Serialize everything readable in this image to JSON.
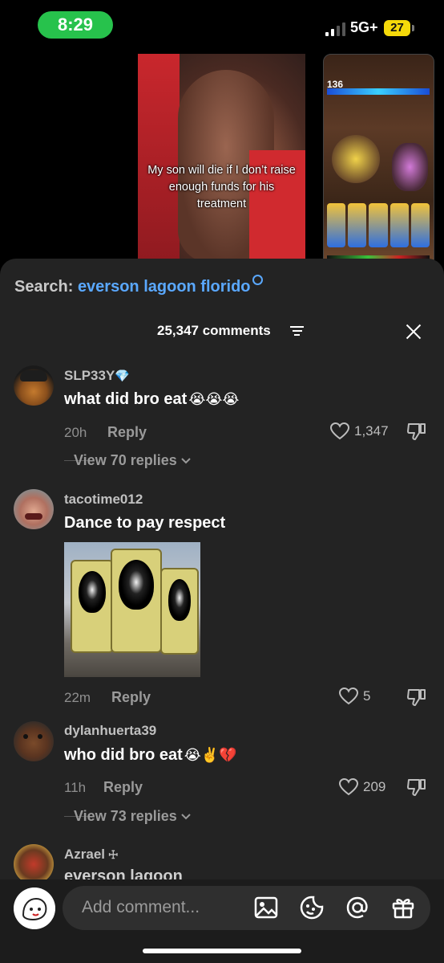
{
  "status_bar": {
    "time": "8:29",
    "network": "5G+",
    "battery": "27"
  },
  "video_left": {
    "caption": "My son will die if I don’t raise enough funds for his treatment"
  },
  "video_right": {
    "hud_number": "136"
  },
  "search": {
    "label": "Search:",
    "query": "everson lagoon florido"
  },
  "header": {
    "count_label": "25,347 comments"
  },
  "comments": [
    {
      "username": "SLP33Y",
      "badge": "💎",
      "text": "what did bro eat",
      "emojis": "😭😭😭",
      "time": "20h",
      "reply_label": "Reply",
      "likes": "1,347",
      "view_replies": "View 70 replies"
    },
    {
      "username": "tacotime012",
      "text": "Dance to pay respect",
      "time": "22m",
      "reply_label": "Reply",
      "likes": "5"
    },
    {
      "username": "dylanhuerta39",
      "text": "who did bro eat",
      "emojis": "😭✌️💔",
      "time": "11h",
      "reply_label": "Reply",
      "likes": "209",
      "view_replies": "View 73 replies"
    },
    {
      "username": "Azrael",
      "badge": "☩",
      "text": "everson lagoon"
    }
  ],
  "composer": {
    "placeholder": "Add comment..."
  },
  "icons": [
    "image-icon",
    "sticker-icon",
    "mention-icon",
    "gift-icon",
    "heart-icon",
    "dislike-icon",
    "chevron-down-icon",
    "filter-icon",
    "close-icon",
    "search-icon"
  ]
}
